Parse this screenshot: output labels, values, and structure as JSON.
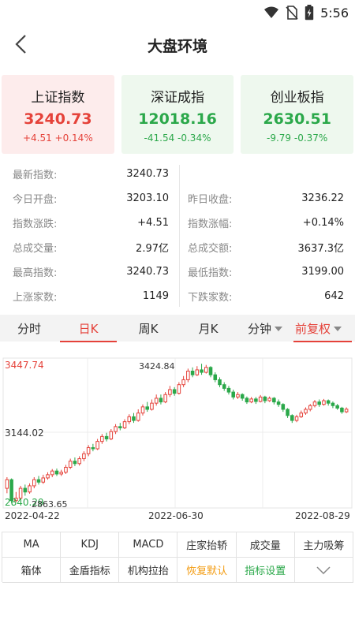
{
  "status_bar": {
    "time": "5:56"
  },
  "header": {
    "title": "大盘环境"
  },
  "index_cards": [
    {
      "name": "上证指数",
      "value": "3240.73",
      "change": "+4.51  +0.14%",
      "trend": "up"
    },
    {
      "name": "深证成指",
      "value": "12018.16",
      "change": "-41.54  -0.34%",
      "trend": "down"
    },
    {
      "name": "创业板指",
      "value": "2630.51",
      "change": "-9.79  -0.37%",
      "trend": "down"
    }
  ],
  "stats": {
    "left": [
      {
        "label": "最新指数:",
        "value": "3240.73",
        "color": "up"
      },
      {
        "label": "今日开盘:",
        "value": "3203.10",
        "color": "down"
      },
      {
        "label": "指数涨跌:",
        "value": "+4.51",
        "color": "up"
      },
      {
        "label": "总成交量:",
        "value": "2.97亿",
        "color": "plain"
      },
      {
        "label": "最高指数:",
        "value": "3240.73",
        "color": "up"
      },
      {
        "label": "上涨家数:",
        "value": "1149",
        "color": "up"
      }
    ],
    "right": [
      {
        "label": "",
        "value": "",
        "color": "plain"
      },
      {
        "label": "昨日收盘:",
        "value": "3236.22",
        "color": "plain"
      },
      {
        "label": "指数涨幅:",
        "value": "+0.14%",
        "color": "up"
      },
      {
        "label": "总成交额:",
        "value": "3637.3亿",
        "color": "plain"
      },
      {
        "label": "最低指数:",
        "value": "3199.00",
        "color": "down"
      },
      {
        "label": "下跌家数:",
        "value": "642",
        "color": "down"
      }
    ]
  },
  "tabs": [
    {
      "label": "分时",
      "active": false,
      "dropdown": false
    },
    {
      "label": "日K",
      "active": true,
      "dropdown": false
    },
    {
      "label": "周K",
      "active": false,
      "dropdown": false
    },
    {
      "label": "月K",
      "active": false,
      "dropdown": false
    },
    {
      "label": "分钟",
      "active": false,
      "dropdown": true
    },
    {
      "label": "前复权",
      "active": true,
      "dropdown": true
    }
  ],
  "chart_data": {
    "type": "candlestick",
    "y_labels": {
      "top": "3447.74",
      "mid": "3144.02",
      "bottom": "2840.29"
    },
    "annotations": {
      "high": "3424.84",
      "low": "2863.65"
    },
    "x_labels": [
      "2022-04-22",
      "2022-06-30",
      "2022-08-29"
    ],
    "ylim": [
      2840.29,
      3447.74
    ],
    "colors": {
      "up": "#e5423a",
      "down": "#2ba84a"
    },
    "candles": [
      [
        2920,
        2955,
        2900,
        2965
      ],
      [
        2955,
        2870,
        2860,
        2960
      ],
      [
        2870,
        2880,
        2863.65,
        2905
      ],
      [
        2880,
        2920,
        2872,
        2930
      ],
      [
        2920,
        2905,
        2890,
        2935
      ],
      [
        2905,
        2930,
        2898,
        2940
      ],
      [
        2930,
        2955,
        2920,
        2965
      ],
      [
        2955,
        2945,
        2935,
        2970
      ],
      [
        2945,
        2962,
        2938,
        2975
      ],
      [
        2962,
        2975,
        2955,
        2985
      ],
      [
        2975,
        2990,
        2965,
        2998
      ],
      [
        2990,
        2978,
        2970,
        3000
      ],
      [
        2978,
        2985,
        2970,
        2995
      ],
      [
        2985,
        3005,
        2978,
        3015
      ],
      [
        3005,
        3030,
        2998,
        3040
      ],
      [
        3030,
        3020,
        3010,
        3045
      ],
      [
        3020,
        3040,
        3012,
        3050
      ],
      [
        3040,
        3060,
        3030,
        3070
      ],
      [
        3060,
        3085,
        3050,
        3095
      ],
      [
        3085,
        3080,
        3070,
        3100
      ],
      [
        3080,
        3110,
        3075,
        3120
      ],
      [
        3110,
        3130,
        3100,
        3140
      ],
      [
        3130,
        3120,
        3110,
        3145
      ],
      [
        3120,
        3150,
        3115,
        3160
      ],
      [
        3150,
        3170,
        3140,
        3180
      ],
      [
        3170,
        3165,
        3155,
        3185
      ],
      [
        3165,
        3190,
        3160,
        3200
      ],
      [
        3190,
        3210,
        3180,
        3220
      ],
      [
        3210,
        3195,
        3185,
        3225
      ],
      [
        3195,
        3225,
        3190,
        3240
      ],
      [
        3225,
        3250,
        3215,
        3260
      ],
      [
        3250,
        3240,
        3230,
        3270
      ],
      [
        3240,
        3265,
        3235,
        3280
      ],
      [
        3265,
        3285,
        3255,
        3300
      ],
      [
        3285,
        3270,
        3260,
        3300
      ],
      [
        3270,
        3300,
        3265,
        3310
      ],
      [
        3300,
        3320,
        3290,
        3335
      ],
      [
        3320,
        3305,
        3295,
        3330
      ],
      [
        3305,
        3340,
        3300,
        3350
      ],
      [
        3340,
        3360,
        3330,
        3375
      ],
      [
        3360,
        3395,
        3350,
        3405
      ],
      [
        3395,
        3380,
        3370,
        3410
      ],
      [
        3380,
        3400,
        3375,
        3415
      ],
      [
        3400,
        3390,
        3380,
        3424.84
      ],
      [
        3390,
        3410,
        3385,
        3420
      ],
      [
        3410,
        3380,
        3370,
        3415
      ],
      [
        3380,
        3360,
        3350,
        3390
      ],
      [
        3360,
        3340,
        3330,
        3370
      ],
      [
        3340,
        3325,
        3315,
        3350
      ],
      [
        3325,
        3310,
        3300,
        3335
      ],
      [
        3310,
        3290,
        3280,
        3320
      ],
      [
        3290,
        3300,
        3282,
        3310
      ],
      [
        3300,
        3285,
        3275,
        3305
      ],
      [
        3285,
        3270,
        3262,
        3292
      ],
      [
        3270,
        3282,
        3265,
        3290
      ],
      [
        3282,
        3272,
        3262,
        3290
      ],
      [
        3272,
        3290,
        3268,
        3298
      ],
      [
        3290,
        3275,
        3265,
        3295
      ],
      [
        3275,
        3285,
        3270,
        3292
      ],
      [
        3285,
        3270,
        3260,
        3290
      ],
      [
        3270,
        3260,
        3250,
        3280
      ],
      [
        3260,
        3240,
        3230,
        3265
      ],
      [
        3240,
        3215,
        3205,
        3245
      ],
      [
        3215,
        3195,
        3185,
        3220
      ],
      [
        3195,
        3210,
        3188,
        3218
      ],
      [
        3210,
        3225,
        3205,
        3235
      ],
      [
        3225,
        3240,
        3218,
        3248
      ],
      [
        3240,
        3255,
        3232,
        3262
      ],
      [
        3255,
        3270,
        3248,
        3278
      ],
      [
        3270,
        3260,
        3250,
        3280
      ],
      [
        3260,
        3275,
        3255,
        3282
      ],
      [
        3275,
        3265,
        3255,
        3280
      ],
      [
        3265,
        3255,
        3245,
        3272
      ],
      [
        3255,
        3245,
        3238,
        3262
      ],
      [
        3245,
        3230,
        3222,
        3250
      ],
      [
        3230,
        3240.73,
        3225,
        3248
      ]
    ]
  },
  "indicators": [
    {
      "label": "MA",
      "style": "plain"
    },
    {
      "label": "KDJ",
      "style": "plain"
    },
    {
      "label": "MACD",
      "style": "plain"
    },
    {
      "label": "庄家抬轿",
      "style": "plain"
    },
    {
      "label": "成交量",
      "style": "plain"
    },
    {
      "label": "主力吸筹",
      "style": "plain"
    },
    {
      "label": "箱体",
      "style": "plain"
    },
    {
      "label": "金盾指标",
      "style": "plain"
    },
    {
      "label": "机构拉抬",
      "style": "plain"
    },
    {
      "label": "恢复默认",
      "style": "orange"
    },
    {
      "label": "指标设置",
      "style": "green"
    },
    {
      "label": "",
      "style": "chevron"
    }
  ]
}
